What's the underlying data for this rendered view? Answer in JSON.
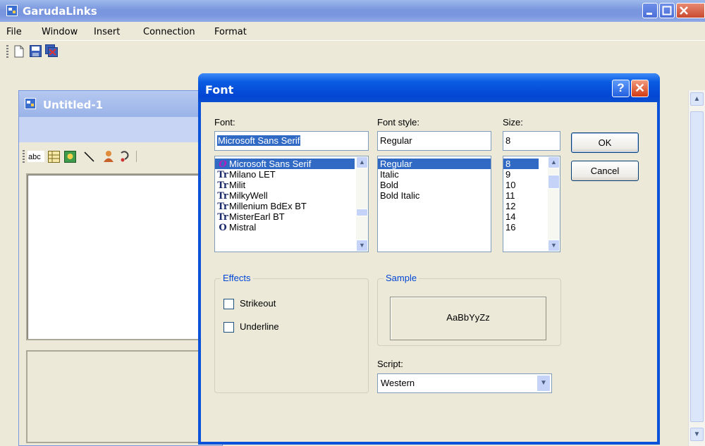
{
  "app": {
    "title": "GarudaLinks",
    "menu": [
      "File",
      "Window",
      "Insert",
      "Connection",
      "Format"
    ],
    "doc_title": "Untitled-1"
  },
  "dialog": {
    "title": "Font",
    "help_glyph": "?",
    "close_glyph": "✕",
    "font": {
      "label": "Font:",
      "value": "Microsoft Sans Serif",
      "items": [
        {
          "name": "Microsoft Sans Serif",
          "icon": "O",
          "selected": true
        },
        {
          "name": "Milano LET",
          "icon": "Tr",
          "selected": false
        },
        {
          "name": "Milit",
          "icon": "Tr",
          "selected": false
        },
        {
          "name": "MilkyWell",
          "icon": "Tr",
          "selected": false
        },
        {
          "name": "Millenium BdEx BT",
          "icon": "Tr",
          "selected": false
        },
        {
          "name": "MisterEarl BT",
          "icon": "Tr",
          "selected": false
        },
        {
          "name": "Mistral",
          "icon": "O",
          "selected": false
        }
      ]
    },
    "style": {
      "label": "Font style:",
      "value": "Regular",
      "items": [
        "Regular",
        "Italic",
        "Bold",
        "Bold Italic"
      ],
      "selected_index": 0
    },
    "size": {
      "label": "Size:",
      "value": "8",
      "items": [
        "8",
        "9",
        "10",
        "11",
        "12",
        "14",
        "16"
      ],
      "selected_index": 0
    },
    "ok_label": "OK",
    "cancel_label": "Cancel",
    "effects": {
      "label": "Effects",
      "strikeout": "Strikeout",
      "underline": "Underline",
      "strikeout_checked": false,
      "underline_checked": false
    },
    "sample": {
      "label": "Sample",
      "text": "AaBbYyZz"
    },
    "script": {
      "label": "Script:",
      "value": "Western"
    }
  },
  "colors": {
    "dialog_title": "#0A53D8",
    "selection": "#316AC5",
    "group_label": "#0046D5"
  }
}
